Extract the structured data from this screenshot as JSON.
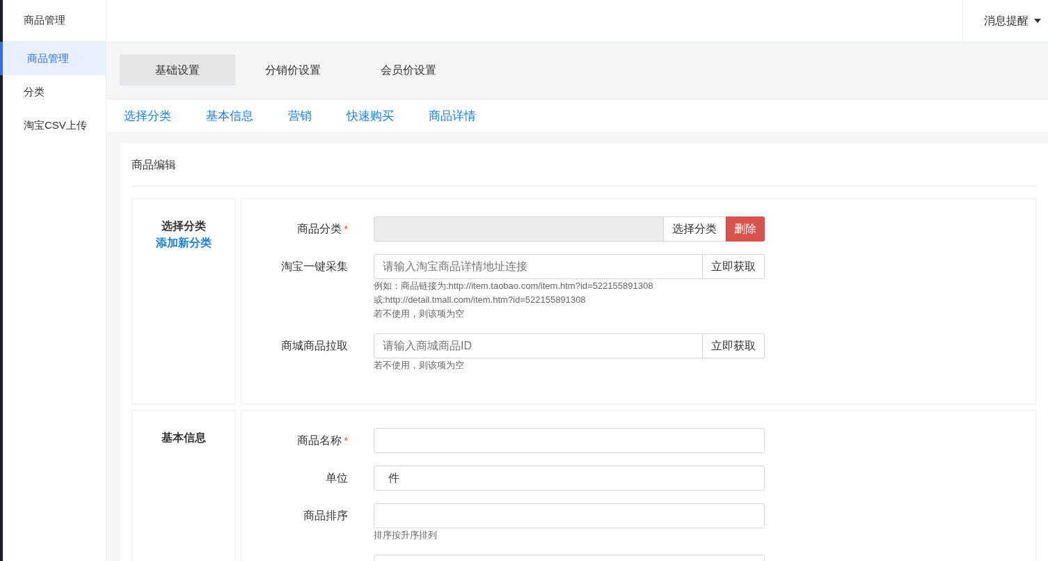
{
  "brand": "商品管理",
  "header": {
    "notice": "消息提醒"
  },
  "sidebar": {
    "items": [
      {
        "label": "商品管理",
        "selected": true
      },
      {
        "label": "分类",
        "selected": false
      },
      {
        "label": "淘宝CSV上传",
        "selected": false
      }
    ]
  },
  "tabs": [
    {
      "label": "基础设置",
      "selected": true
    },
    {
      "label": "分销价设置",
      "selected": false
    },
    {
      "label": "会员价设置",
      "selected": false
    }
  ],
  "anchors": [
    "选择分类",
    "基本信息",
    "营销",
    "快速购买",
    "商品详情"
  ],
  "card": {
    "title": "商品编辑",
    "sections": [
      {
        "title": "选择分类",
        "link": "添加新分类",
        "fields": [
          {
            "kind": "category",
            "label": "商品分类",
            "mark": "*",
            "buttons": [
              "选择分类",
              "删除"
            ]
          },
          {
            "kind": "fetch",
            "label": "淘宝一键采集",
            "placeholder": "请输入淘宝商品详情地址连接",
            "button": "立即获取",
            "help": [
              "例如：商品链接为:http://item.taobao.com/item.htm?id=522155891308",
              "或:http://detail.tmall.com/item.htm?id=522155891308",
              "若不使用，则该项为空"
            ]
          },
          {
            "kind": "fetch",
            "label": "商城商品拉取",
            "placeholder": "请输入商城商品ID",
            "button": "立即获取",
            "help": [
              "若不使用，则该项为空"
            ]
          }
        ]
      },
      {
        "title": "基本信息",
        "fields": [
          {
            "kind": "text",
            "label": "商品名称",
            "mark": "*"
          },
          {
            "kind": "text",
            "label": "单位",
            "value": "件"
          },
          {
            "kind": "text",
            "label": "商品排序",
            "help": [
              "排序按升序排列"
            ]
          },
          {
            "kind": "cut"
          }
        ]
      }
    ]
  }
}
